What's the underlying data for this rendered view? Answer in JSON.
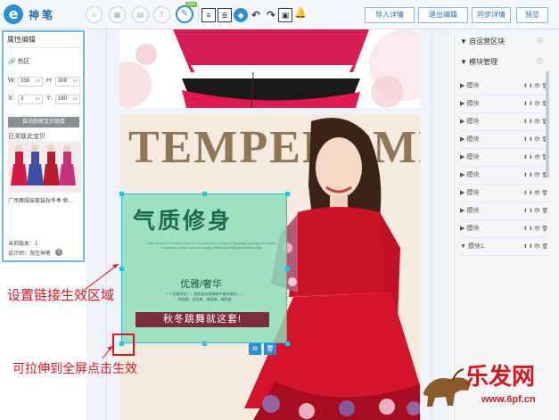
{
  "app": {
    "logo_letter": "e",
    "name": "神笔"
  },
  "toolbar": {
    "badge": "new",
    "actions": [
      "导入详情",
      "退出编辑",
      "同步详情",
      "预览"
    ]
  },
  "left_panel": {
    "title": "属性编辑",
    "section": "热区",
    "w_label": "W:",
    "w_value": "338",
    "h_label": "H:",
    "h_value": "309",
    "x_label": "X:",
    "x_value": "3",
    "y_label": "Y:",
    "y_value": "160",
    "unit": "px",
    "auto_link_button": "自动获取宝贝链接",
    "linked_label": "已关联此宝贝",
    "product_name": "广场舞服装套装秋冬季 新...",
    "version": "当前版本：1",
    "designer": "设计师：淘宝神笔",
    "version_badge": "1"
  },
  "canvas": {
    "banner_title": "TEMPERAMENT",
    "hotspot": {
      "headline": "气质修身",
      "small_text": "Stray kinds of summer come to my window to sing and fly away. And yellow leaves of autumn, which have no songs, flutter and fall there with a sigh",
      "subhead": "优雅/奢华",
      "desc_line1": "一个优雅的女人，就应该有着精神中美的姿态——",
      "desc_line2": "成熟着，自信着，美丽着，精致着",
      "banner": "秋冬跳舞就这套!"
    }
  },
  "annotations": {
    "link_area": "设置链接生效区域",
    "stretch": "可拉伸到全屏点击生效"
  },
  "right_panel": {
    "section1": "自运营区块",
    "section2": "模块管理",
    "modules": [
      "模块",
      "模块",
      "模块",
      "模块",
      "模块",
      "模块",
      "模块",
      "模块",
      "模块",
      "模块1"
    ]
  },
  "watermark": {
    "text": "乐发网",
    "url": "www.6pf.cn"
  },
  "colors": {
    "accent": "#2a8fd6",
    "hotspot_fill": "#8adebc",
    "annotation_red": "#e0121e",
    "banner_maroon": "#7b2d3e"
  }
}
